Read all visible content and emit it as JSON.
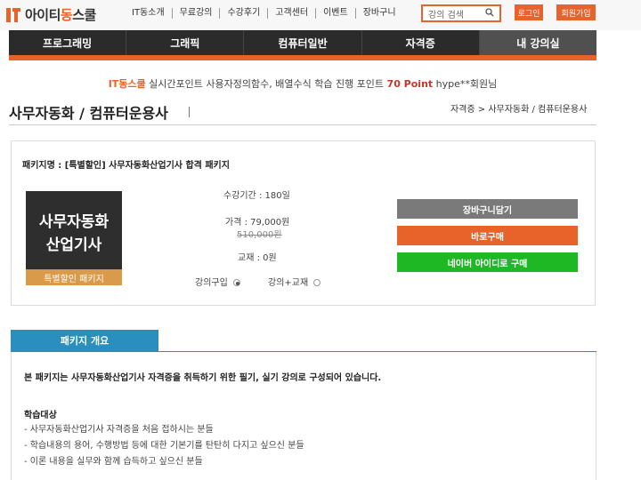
{
  "header": {
    "logo_brand": "아이티",
    "logo_accent": "동",
    "logo_suffix": "스쿨",
    "links": [
      "IT동소개",
      "무료강의",
      "수강후기",
      "고객센터",
      "이벤트",
      "장바구니"
    ],
    "search_placeholder": "강의 검색",
    "login_label": "로그인",
    "join_label": "회원가입"
  },
  "main_nav": [
    "프로그래밍",
    "그래픽",
    "컴퓨터일반",
    "자격증",
    "내 강의실"
  ],
  "promo": {
    "brand": "IT동스쿨",
    "text1": " 실시간포인트 사용자정의함수, 배열수식 학습 진행 포인트 ",
    "points": "70 Point",
    "text2": " hype**회원님"
  },
  "page": {
    "title": "사무자동화 / 컴퓨터운용사",
    "breadcrumb": "자격증 > 사무자동화 / 컴퓨터운용사"
  },
  "package": {
    "name_label": "패키지명 : [특별할인] 사무자동화산업기사 합격 패키지",
    "thumb_line1": "사무자동화",
    "thumb_line2": "산업기사",
    "thumb_band": "특별할인 패키지",
    "period": "수강기간 : 180일",
    "price": "가격 : 79,000원",
    "original_price": "510,000원",
    "textbook": "교재 : 0원",
    "option_lecture": "강의구입",
    "option_lecture_textbook": "강의+교재",
    "cart_button": "장바구니담기",
    "buy_button": "바로구매",
    "naver_button": "네이버 아이디로 구매"
  },
  "overview": {
    "tab_label": "패키지 개요",
    "intro": "본 패키지는 사무자동화산업기사 자격증을 취득하기 위한 필기, 실기 강의로 구성되어 있습니다.",
    "target_title": "학습대상",
    "targets": [
      "- 사무자동화산업기사 자격증을 처음 접하시는 분들",
      "- 학습내용의 용어, 수행방법 등에 대한 기본기를 탄탄히 다지고 싶으신 분들",
      "- 이론 내용을 실무와 함께 습득하고 싶으신 분들"
    ]
  },
  "colors": {
    "accent": "#e8632a",
    "nav_bg": "#2b2b2b",
    "cart": "#7a7a7a",
    "naver": "#1db824",
    "tab": "#2a8fbf"
  }
}
